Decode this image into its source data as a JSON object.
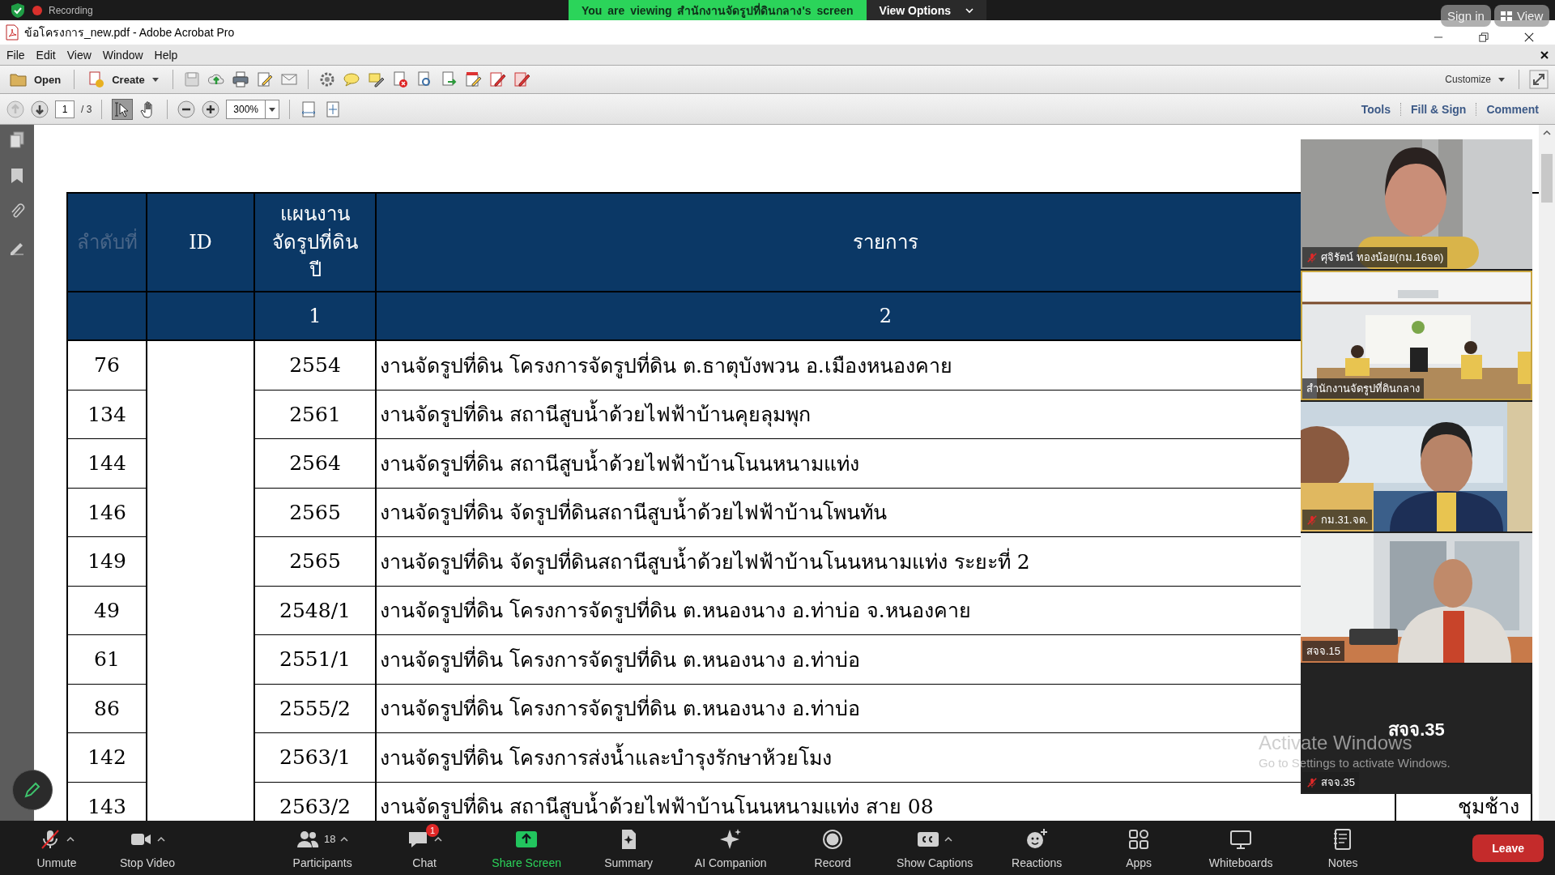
{
  "meeting_bar": {
    "recording": "Recording",
    "banner": "You are viewing สำนักงานจัดรูปที่ดินกลาง's screen",
    "view_options": "View Options",
    "sign_in": "Sign in",
    "view": "View"
  },
  "window": {
    "title": "ข้อโครงการ_new.pdf - Adobe Acrobat Pro"
  },
  "menu": [
    "File",
    "Edit",
    "View",
    "Window",
    "Help"
  ],
  "toolbar": {
    "open": "Open",
    "create": "Create",
    "customize": "Customize"
  },
  "navigation": {
    "page": "1",
    "page_count": "/ 3",
    "zoom": "300%"
  },
  "panes": [
    "Tools",
    "Fill & Sign",
    "Comment"
  ],
  "table": {
    "columns": [
      {
        "label": "ลำดับที่",
        "dim": true
      },
      {
        "label": "ID",
        "dim": false
      },
      {
        "label": "แผนงาน\nจัดรูปที่ดิน\nปี",
        "dim": false,
        "number": "1"
      },
      {
        "label": "รายการ",
        "dim": false,
        "number": "2"
      }
    ],
    "rows": [
      {
        "no": "76",
        "year": "2554",
        "item": "งานจัดรูปที่ดิน โครงการจัดรูปที่ดิน ต.ธาตุบังพวน อ.เมืองหนองคาย"
      },
      {
        "no": "134",
        "year": "2561",
        "item": "งานจัดรูปที่ดิน สถานีสูบน้ำด้วยไฟฟ้าบ้านคุยลุมพุก"
      },
      {
        "no": "144",
        "year": "2564",
        "item": "งานจัดรูปที่ดิน สถานีสูบน้ำด้วยไฟฟ้าบ้านโนนหนามแท่ง"
      },
      {
        "no": "146",
        "year": "2565",
        "item": "งานจัดรูปที่ดิน จัดรูปที่ดินสถานีสูบน้ำด้วยไฟฟ้าบ้านโพนทัน"
      },
      {
        "no": "149",
        "year": "2565",
        "item": "งานจัดรูปที่ดิน จัดรูปที่ดินสถานีสูบน้ำด้วยไฟฟ้าบ้านโนนหนามแท่ง ระยะที่ 2"
      },
      {
        "no": "49",
        "year": "2548/1",
        "item": "งานจัดรูปที่ดิน โครงการจัดรูปที่ดิน ต.หนองนาง อ.ท่าบ่อ จ.หนองคาย"
      },
      {
        "no": "61",
        "year": "2551/1",
        "item": "งานจัดรูปที่ดิน โครงการจัดรูปที่ดิน ต.หนองนาง อ.ท่าบ่อ"
      },
      {
        "no": "86",
        "year": "2555/2",
        "item": "งานจัดรูปที่ดิน โครงการจัดรูปที่ดิน ต.หนองนาง อ.ท่าบ่อ"
      },
      {
        "no": "142",
        "year": "2563/1",
        "item": "งานจัดรูปที่ดิน โครงการส่งน้ำและบำรุงรักษาห้วยโมง"
      },
      {
        "no": "143",
        "year": "2563/2",
        "item": "งานจัดรูปที่ดิน สถานีสูบน้ำด้วยไฟฟ้าบ้านโนนหนามแท่ง สาย 08",
        "column_5": "ชุมช้าง"
      }
    ]
  },
  "participants": [
    {
      "name": "ศุจิรัตน์ ทองน้อย(กม.16จด)",
      "muted": true,
      "kind": "video"
    },
    {
      "name": "สำนักงานจัดรูปที่ดินกลาง",
      "muted": false,
      "kind": "video"
    },
    {
      "name": "กม.31.จด.",
      "muted": true,
      "kind": "video"
    },
    {
      "name": "สจจ.15",
      "muted": false,
      "kind": "video"
    },
    {
      "name": "สจจ.35",
      "muted": true,
      "kind": "name_only",
      "display_name": "สจจ.35"
    }
  ],
  "activation_notice": {
    "title": "Activate Windows",
    "text": "Go to Settings to activate Windows."
  },
  "controls": [
    {
      "label": "Unmute",
      "kind": "mic",
      "menu_caret": true
    },
    {
      "label": "Stop Video",
      "kind": "camera",
      "menu_caret": true
    },
    {
      "label": "Participants",
      "kind": "people",
      "menu_caret": true,
      "count": "18"
    },
    {
      "label": "Chat",
      "kind": "chat",
      "menu_caret": true,
      "badge": "1"
    },
    {
      "label": "Share Screen",
      "kind": "share",
      "menu_caret": false
    },
    {
      "label": "Summary",
      "kind": "summary",
      "menu_caret": false
    },
    {
      "label": "AI Companion",
      "kind": "sparkle",
      "menu_caret": false
    },
    {
      "label": "Record",
      "kind": "record",
      "menu_caret": false
    },
    {
      "label": "Show Captions",
      "kind": "captions",
      "menu_caret": true
    },
    {
      "label": "Reactions",
      "kind": "reactions",
      "menu_caret": false
    },
    {
      "label": "Apps",
      "kind": "apps",
      "menu_caret": false
    },
    {
      "label": "Whiteboards",
      "kind": "whiteboard",
      "menu_caret": false
    },
    {
      "label": "Notes",
      "kind": "notes",
      "menu_caret": false
    }
  ],
  "leave": "Leave"
}
